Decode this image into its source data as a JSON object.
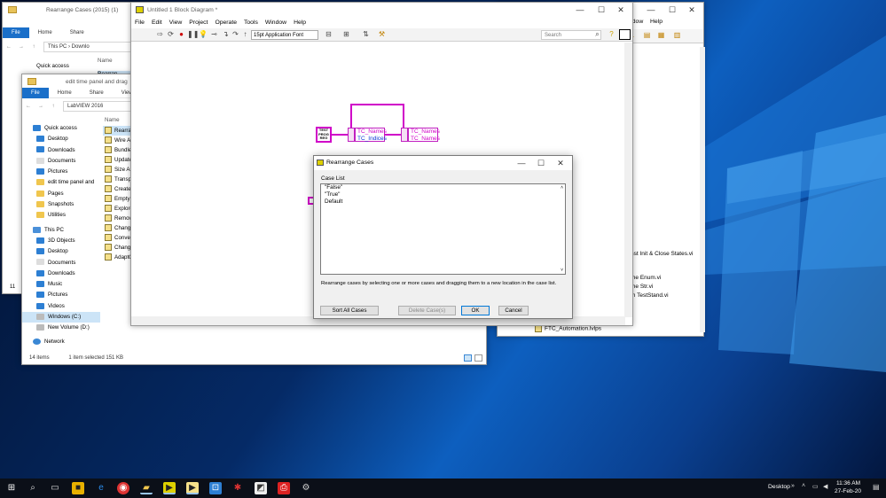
{
  "colors": {
    "accent": "#1a6fc9",
    "wire": "#d000c8",
    "selection": "#cce4f7",
    "taskbar": "#0b0f18"
  },
  "explorer_back": {
    "title": "Rearrange Cases (2015) (1)",
    "address": "This PC › Downlo",
    "col_name": "Name",
    "first_file": "Rearran",
    "quick_access": "Quick access",
    "partial_status": "11"
  },
  "explorer": {
    "title": "edit time panel and drag",
    "ribbon": {
      "file": "File",
      "home": "Home",
      "share": "Share",
      "view": "View"
    },
    "address": "LabVIEW 2016",
    "col_name": "Name",
    "sidebar": [
      {
        "label": "Quick access",
        "icon": "star-icon"
      },
      {
        "label": "Desktop",
        "icon": "desktop-icon"
      },
      {
        "label": "Downloads",
        "icon": "downloads-icon"
      },
      {
        "label": "Documents",
        "icon": "documents-icon"
      },
      {
        "label": "Pictures",
        "icon": "pictures-icon"
      },
      {
        "label": "edit time panel and",
        "icon": "folder-icon"
      },
      {
        "label": "Pages",
        "icon": "folder-icon"
      },
      {
        "label": "Snapshots",
        "icon": "folder-icon"
      },
      {
        "label": "Utilities",
        "icon": "folder-icon"
      },
      {
        "label": "This PC",
        "icon": "pc-icon"
      },
      {
        "label": "3D Objects",
        "icon": "folder-icon"
      },
      {
        "label": "Desktop",
        "icon": "desktop-icon"
      },
      {
        "label": "Documents",
        "icon": "documents-icon"
      },
      {
        "label": "Downloads",
        "icon": "downloads-icon"
      },
      {
        "label": "Music",
        "icon": "music-icon"
      },
      {
        "label": "Pictures",
        "icon": "pictures-icon"
      },
      {
        "label": "Videos",
        "icon": "videos-icon"
      },
      {
        "label": "Windows (C:)",
        "icon": "drive-icon"
      },
      {
        "label": "New Volume (D:)",
        "icon": "drive-icon"
      },
      {
        "label": "Network",
        "icon": "network-icon"
      }
    ],
    "files": [
      "Rearran",
      "Wire Al",
      "Bundle",
      "Update",
      "Size Ar",
      "Transpo",
      "Create",
      "Empty",
      "Explore",
      "Remov",
      "Chang",
      "Conver",
      "Chang",
      "AdaptC"
    ],
    "status_items": "14 items",
    "status_selected": "1 item selected  151 KB"
  },
  "block_diagram": {
    "title": "Untitled 1 Block Diagram *",
    "menu": [
      "File",
      "Edit",
      "View",
      "Project",
      "Operate",
      "Tools",
      "Window",
      "Help"
    ],
    "font_select": "15pt Application Font",
    "search_placeholder": "Search",
    "constant_label": [
      "TEST",
      "PROG",
      "REG"
    ],
    "terminal_left": [
      "TC_Names",
      "TC_Indices"
    ],
    "terminal_right": [
      "TC_Names",
      "TC_Names"
    ]
  },
  "dialog": {
    "title": "Rearrange Cases",
    "list_label": "Case List",
    "cases": [
      "\"False\"",
      "\"True\"",
      "Default"
    ],
    "hint": "Rearrange cases by selecting one or more cases and dragging them to a new location in the case list.",
    "buttons": {
      "sort": "Sort All Cases",
      "delete": "Delete Case(s)",
      "ok": "OK",
      "cancel": "Cancel"
    }
  },
  "project_window": {
    "menu": [
      "ndow",
      "Help"
    ],
    "items": [
      "nst Init & Close States.vi",
      "me Enum.vi",
      "me Str.vi",
      "m TestStand.vi",
      "FTC_Automation.lvlps"
    ]
  },
  "taskbar": {
    "desktop_label": "Desktop",
    "time": "11:36 AM",
    "date": "27-Feb-20"
  }
}
